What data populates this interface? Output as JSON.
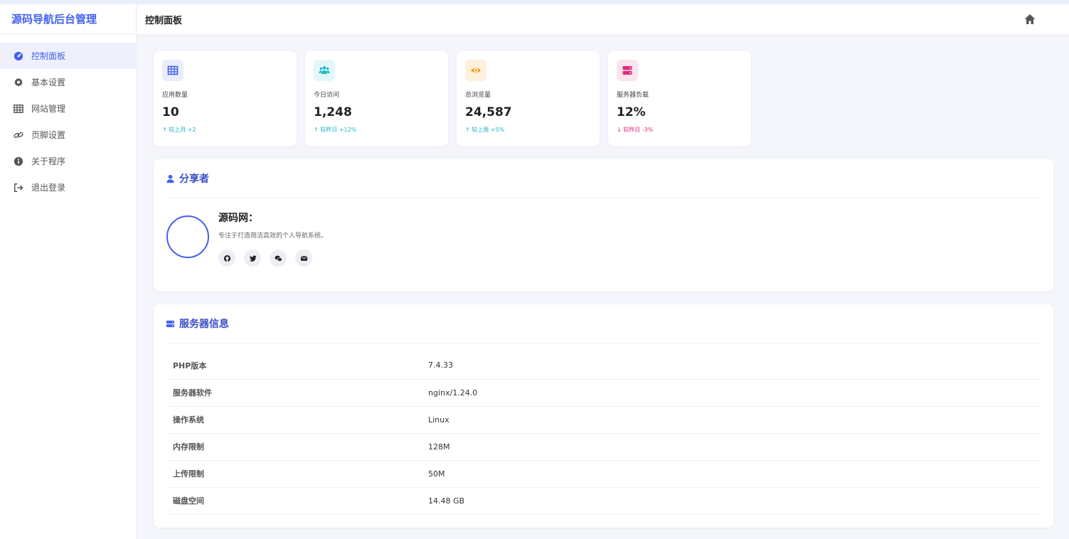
{
  "brand": "源码导航后台管理",
  "sidebar": {
    "items": [
      {
        "label": "控制面板",
        "icon": "dashboard-icon",
        "active": true
      },
      {
        "label": "基本设置",
        "icon": "gear-icon",
        "active": false
      },
      {
        "label": "网站管理",
        "icon": "grid-icon",
        "active": false
      },
      {
        "label": "页脚设置",
        "icon": "link-icon",
        "active": false
      },
      {
        "label": "关于程序",
        "icon": "info-icon",
        "active": false
      },
      {
        "label": "退出登录",
        "icon": "logout-icon",
        "active": false
      }
    ]
  },
  "header": {
    "title": "控制面板",
    "home_icon": "home-icon"
  },
  "stats": [
    {
      "label": "应用数量",
      "value": "10",
      "trend": "↑ 较上月 +2",
      "direction": "up",
      "icon": "grid-icon",
      "color": "#4361ee",
      "bg": "#e9edfc"
    },
    {
      "label": "今日访问",
      "value": "1,248",
      "trend": "↑ 较昨日 +12%",
      "direction": "up",
      "icon": "users-icon",
      "color": "#19b6c9",
      "bg": "#e3f7fa"
    },
    {
      "label": "总浏览量",
      "value": "24,587",
      "trend": "↑ 较上周 +5%",
      "direction": "up",
      "icon": "eye-icon",
      "color": "#f39c12",
      "bg": "#fdf0dd"
    },
    {
      "label": "服务器负载",
      "value": "12%",
      "trend": "↓ 较昨日 -3%",
      "direction": "down",
      "icon": "server-icon",
      "color": "#e0287d",
      "bg": "#fce4ef"
    }
  ],
  "sharer": {
    "title": "分享者",
    "name": "源码网：",
    "description": "专注于打造简洁高效的个人导航系统。",
    "socials": [
      "github-icon",
      "twitter-icon",
      "wechat-icon",
      "mail-icon"
    ]
  },
  "server_info": {
    "title": "服务器信息",
    "rows": [
      {
        "key": "PHP版本",
        "value": "7.4.33"
      },
      {
        "key": "服务器软件",
        "value": "nginx/1.24.0"
      },
      {
        "key": "操作系统",
        "value": "Linux"
      },
      {
        "key": "内存限制",
        "value": "128M"
      },
      {
        "key": "上传限制",
        "value": "50M"
      },
      {
        "key": "磁盘空间",
        "value": "14.48 GB"
      }
    ]
  },
  "colors": {
    "accent": "#4361ee",
    "up": "#19b6c9",
    "down": "#e0287d"
  }
}
